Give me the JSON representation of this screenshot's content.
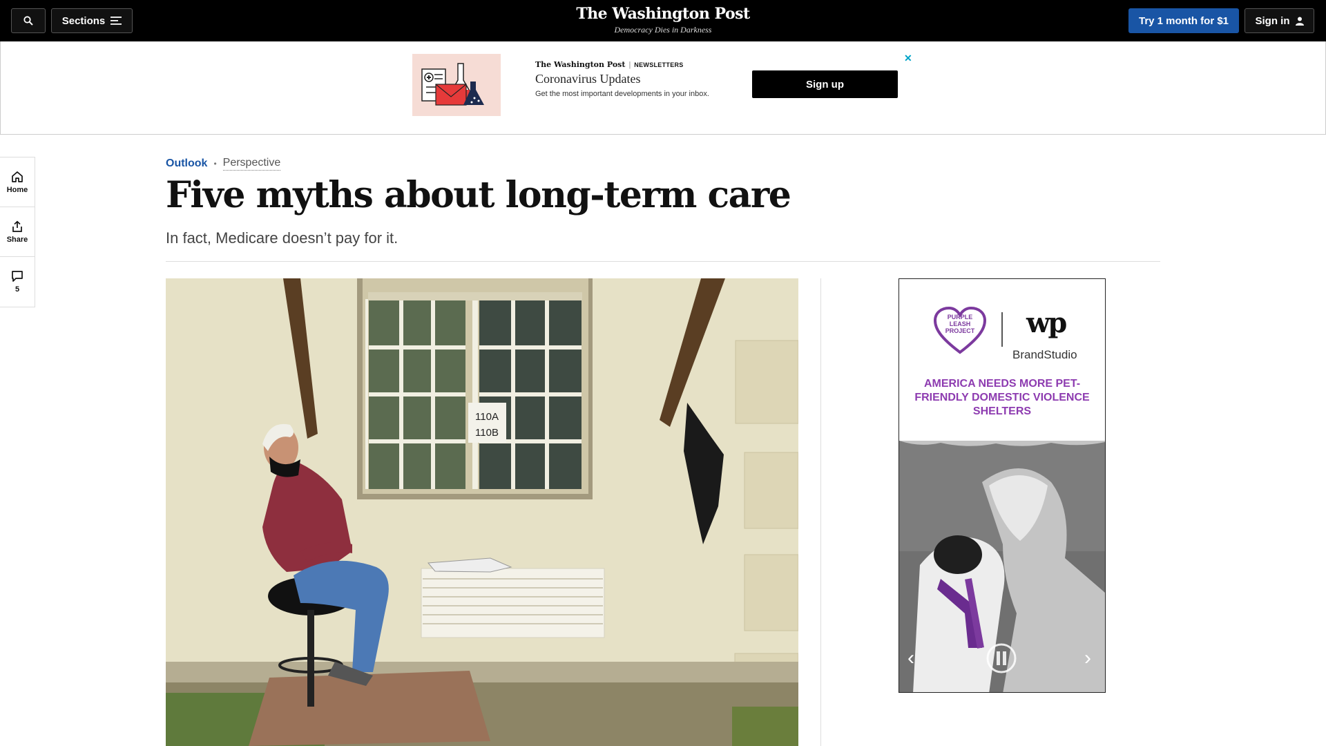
{
  "nav": {
    "sections_label": "Sections",
    "logo": "The Washington Post",
    "tagline": "Democracy Dies in Darkness",
    "try_label": "Try 1 month for $1",
    "signin_label": "Sign in"
  },
  "banner": {
    "brand": "The Washington Post",
    "newsletters": "NEWSLETTERS",
    "title": "Coronavirus Updates",
    "description": "Get the most important developments in your inbox.",
    "signup_label": "Sign up",
    "close_glyph": "✕"
  },
  "rail": {
    "home_label": "Home",
    "share_label": "Share",
    "comments_count": "5"
  },
  "article": {
    "section": "Outlook",
    "kicker": "Perspective",
    "headline": "Five myths about long-term care",
    "dek": "In fact, Medicare doesn’t pay for it.",
    "image_sign_line1": "110A",
    "image_sign_line2": "110B"
  },
  "ad": {
    "logo_text": "PURPLE LEASH PROJECT",
    "wp_mark": "wp",
    "brandstudio": "BrandStudio",
    "headline": "AMERICA NEEDS MORE PET-FRIENDLY DOMESTIC VIOLENCE SHELTERS",
    "prev_glyph": "‹",
    "next_glyph": "›"
  },
  "colors": {
    "accent_blue": "#1955a5",
    "ad_purple": "#8d3bb0",
    "banner_close": "#00a3c7"
  },
  "icons": [
    "search-icon",
    "menu-icon",
    "user-icon",
    "home-icon",
    "share-icon",
    "comment-icon",
    "pause-icon",
    "chevron-left-icon",
    "chevron-right-icon"
  ]
}
